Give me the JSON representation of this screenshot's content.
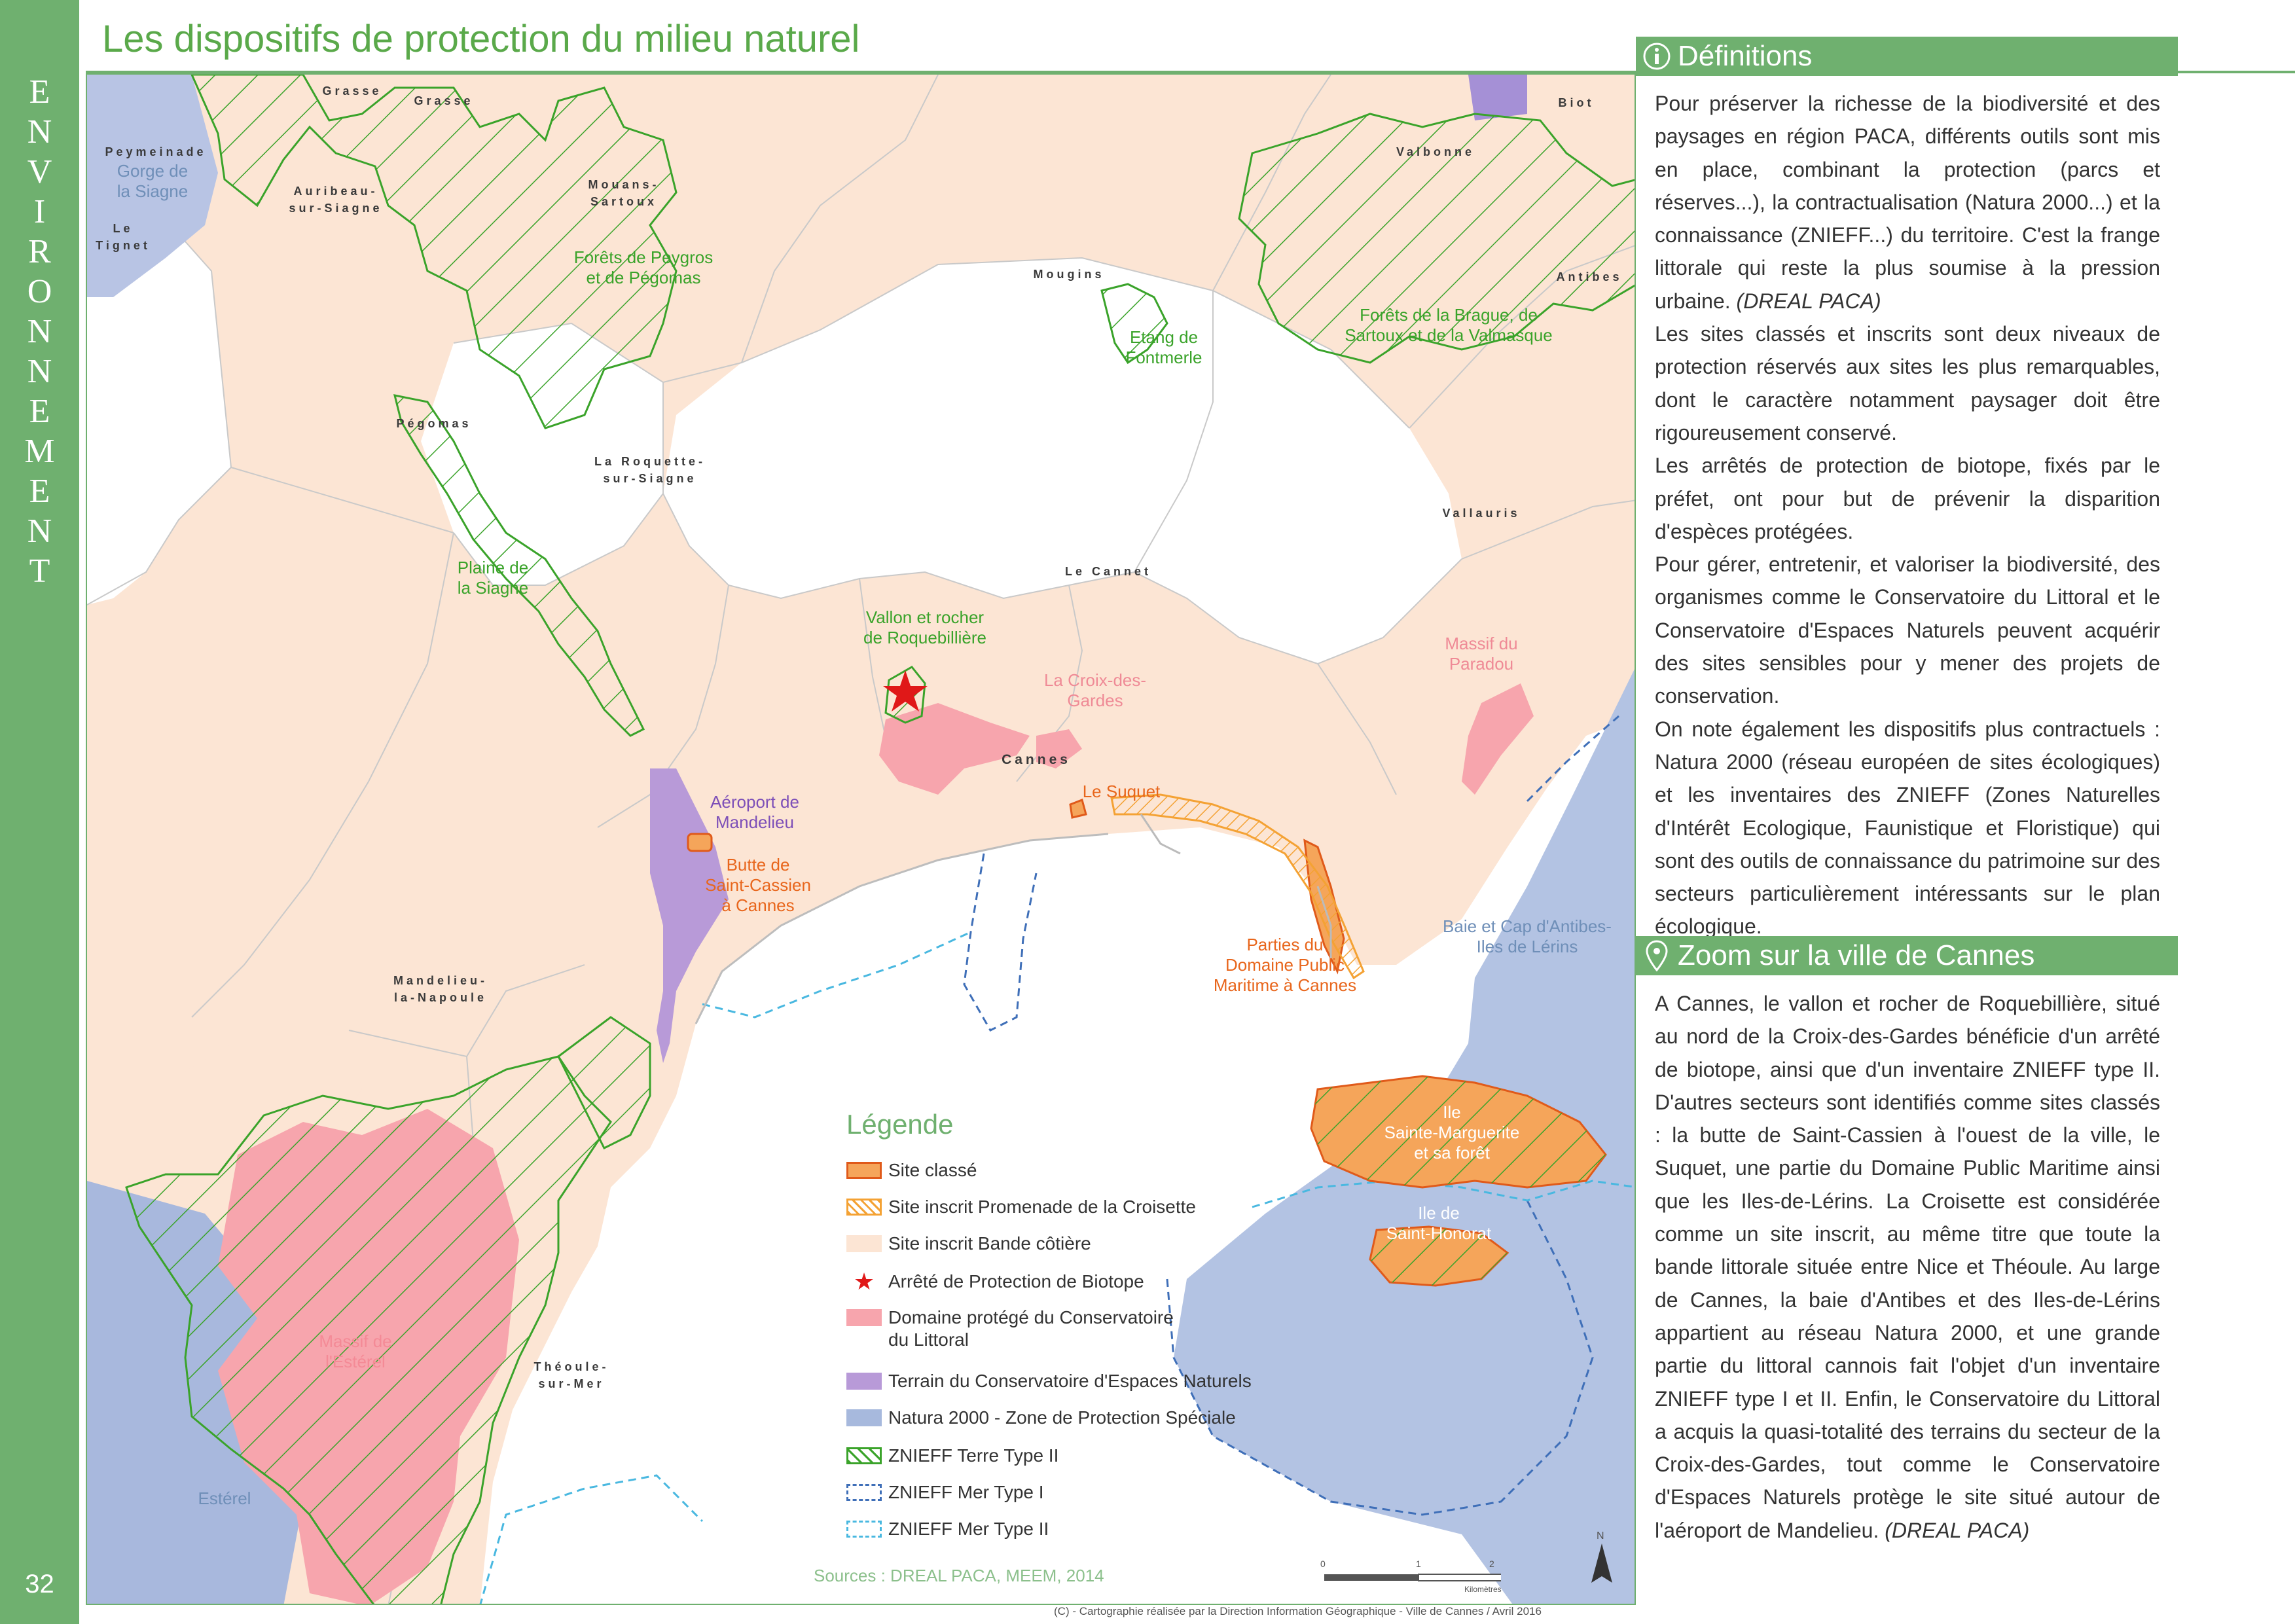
{
  "sidebar": {
    "section_letters": [
      "E",
      "N",
      "V",
      "I",
      "R",
      "O",
      "N",
      "N",
      "E",
      "M",
      "E",
      "N",
      "T"
    ],
    "page_number": "32"
  },
  "header": {
    "title": "Les dispositifs de protection du milieu naturel"
  },
  "map": {
    "places": {
      "grasse_1": "Grasse",
      "grasse_2": "Grasse",
      "biot": "Biot",
      "peymeinade": "Peymeinade",
      "auribeau": "Auribeau-\nsur-Siagne",
      "mouans": "Mouans-\nSartoux",
      "valbonne": "Valbonne",
      "le_tignet": "Le\nTignet",
      "mougins": "Mougins",
      "antibes": "Antibes",
      "pegomas": "Pégomas",
      "la_roquette": "La Roquette-\nsur-Siagne",
      "vallauris": "Vallauris",
      "le_cannet": "Le Cannet",
      "cannes": "Cannes",
      "mandelieu": "Mandelieu-\nla-Napoule",
      "theoule": "Théoule-\nsur-Mer"
    },
    "labels": {
      "gorge_siagne": "Gorge de\nla Siagne",
      "forets_peygros": "Forêts de Peygros\net de Pégomas",
      "etang_fontmerle": "Etang de\nFontmerle",
      "forets_brague": "Forêts de la Brague, de\nSartoux et de la Valmasque",
      "plaine_siagne": "Plaine de\nla Siagne",
      "vallon_roquebilliere": "Vallon et rocher\nde Roquebillière",
      "la_croix_des_gardes": "La Croix-des-\nGardes",
      "massif_paradou": "Massif du\nParadou",
      "aeroport_mandelieu": "Aéroport de\nMandelieu",
      "butte_saint_cassien": "Butte de\nSaint-Cassien\nà Cannes",
      "le_suquet": "Le Suquet",
      "parties_domaine": "Parties du\nDomaine Public\nMaritime à Cannes",
      "baie_cap_antibes": "Baie et Cap d'Antibes-\nIles de Lérins",
      "ile_sainte_marguerite": "Ile\nSainte-Marguerite\net sa forêt",
      "ile_saint_honorat": "Ile de\nSaint-Honorat",
      "massif_esterel": "Massif de\nl'Estérel",
      "esterel": "Estérel"
    },
    "legend": {
      "title": "Légende",
      "items": [
        {
          "label": "Site classé",
          "icon": "site-classe-swatch"
        },
        {
          "label": "Site inscrit Promenade de la Croisette",
          "icon": "site-inscrit-croisette-swatch"
        },
        {
          "label": "Site inscrit Bande côtière",
          "icon": "site-inscrit-bande-swatch"
        },
        {
          "label": "Arrêté de Protection de Biotope",
          "icon": "star-icon"
        },
        {
          "label": "Domaine protégé du Conservatoire\ndu Littoral",
          "icon": "conservatoire-littoral-swatch"
        },
        {
          "label": "Terrain du Conservatoire d'Espaces Naturels",
          "icon": "conservatoire-espaces-swatch"
        },
        {
          "label": "Natura 2000 - Zone de Protection Spéciale",
          "icon": "natura-swatch"
        },
        {
          "label": "ZNIEFF Terre Type II",
          "icon": "znieff-terre-swatch"
        },
        {
          "label": "ZNIEFF Mer Type I",
          "icon": "znieff-mer-1-swatch"
        },
        {
          "label": "ZNIEFF Mer Type II",
          "icon": "znieff-mer-2-swatch"
        }
      ]
    },
    "sources": "Sources : DREAL PACA, MEEM, 2014",
    "scale": {
      "ticks": [
        "0",
        "1",
        "2"
      ],
      "unit": "Kilomètres"
    },
    "north_label": "N",
    "credits": "(C) - Cartographie réalisée par la Direction Information Géographique - Ville de Cannes / Avril 2016"
  },
  "colors": {
    "accent_green": "#6fb06f",
    "bande_cotiere": "#fce5d4",
    "site_classe": "#f5a55a",
    "conservatoire_littoral": "#f7a5ad",
    "conservatoire_espaces": "#b89ad8",
    "natura_2000": "#a7b9dd",
    "znieff_terre": "#3aa32a"
  },
  "definitions": {
    "title": "Définitions",
    "p1": "Pour préserver la richesse de la biodiversité et des paysages en région PACA, différents outils sont mis en place, combinant la protection (parcs et réserves...), la contractualisation (Natura 2000...) et la connaissance (ZNIEFF...) du territoire. C'est la frange littorale qui reste la plus soumise à la pression urbaine.",
    "p1_source": "(DREAL PACA)",
    "p2": "Les sites classés et inscrits sont deux niveaux de protection réservés aux sites les plus remarquables, dont le caractère notamment paysager doit être rigoureusement conservé.",
    "p3": "Les arrêtés de protection de biotope, fixés par le préfet, ont pour but de prévenir la disparition d'espèces protégées.",
    "p4": "Pour gérer, entretenir, et valoriser la biodiversité, des organismes comme le Conservatoire du Littoral et le Conservatoire d'Espaces Naturels peuvent acquérir des sites sensibles pour y mener des projets de conservation.",
    "p5": "On note également les dispositifs plus contractuels : Natura 2000 (réseau européen de sites écologiques) et les inventaires des ZNIEFF (Zones Naturelles d'Intérêt Ecologique, Faunistique et Floristique) qui sont des outils de connaissance du patrimoine sur des secteurs particulièrement intéressants sur le plan écologique."
  },
  "zoom": {
    "title": "Zoom sur la ville de Cannes",
    "text": "A Cannes, le vallon et rocher de Roquebillière, situé au nord de la Croix-des-Gardes bénéficie d'un arrêté de biotope, ainsi que d'un inventaire ZNIEFF type II. D'autres secteurs sont identifiés comme sites classés : la butte de Saint-Cassien à l'ouest de la ville, le Suquet, une partie du Domaine Public Maritime ainsi que les Iles-de-Lérins. La Croisette est considérée comme un site inscrit, au même titre que toute la bande littorale située entre Nice et Théoule. Au large de Cannes, la baie d'Antibes et des Iles-de-Lérins appartient au réseau Natura 2000, et une grande partie du littoral cannois fait l'objet d'un inventaire ZNIEFF type I et II. Enfin, le Conservatoire du Littoral a acquis la quasi-totalité des terrains du secteur de la Croix-des-Gardes, tout comme le Conservatoire d'Espaces Naturels protège le site situé autour de l'aéroport de Mandelieu.",
    "source": "(DREAL PACA)"
  }
}
